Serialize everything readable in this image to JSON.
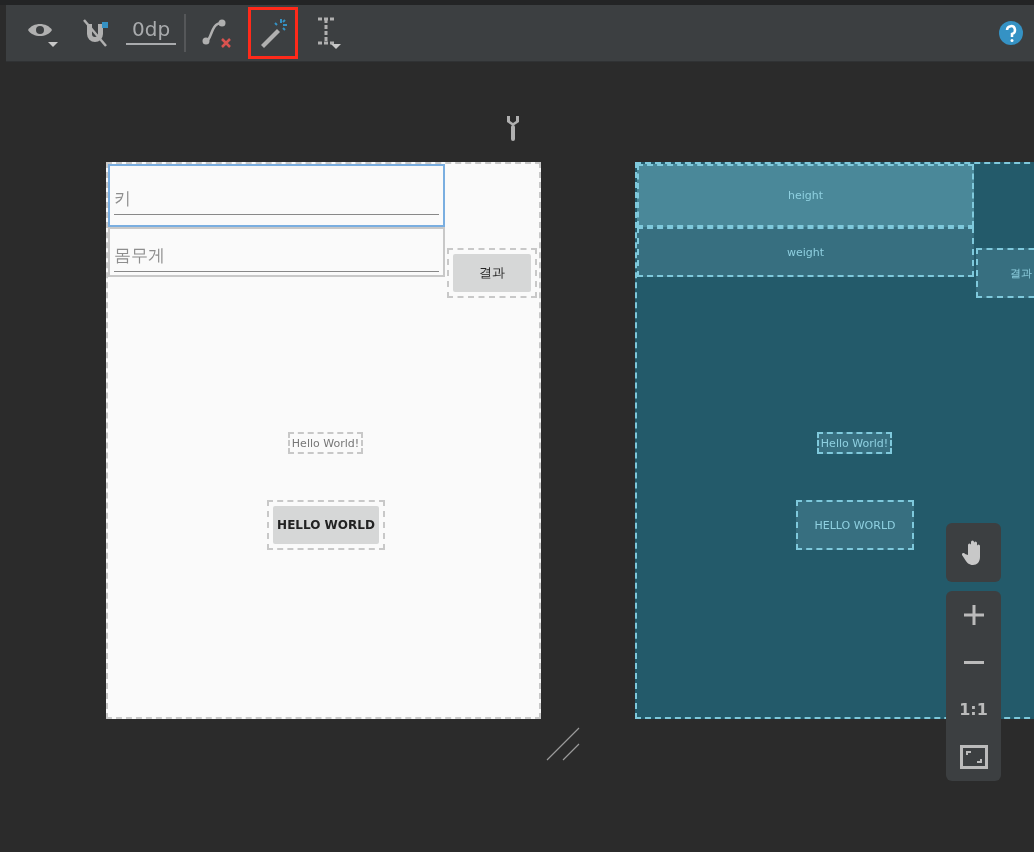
{
  "toolbar": {
    "tools": [
      {
        "kind": "eye",
        "selected": false
      },
      {
        "kind": "magnet",
        "selected": false
      },
      {
        "kind": "margin",
        "label": "0dp",
        "selected": false
      },
      {
        "kind": "clear",
        "selected": false
      },
      {
        "kind": "infer",
        "selected": true
      },
      {
        "kind": "align",
        "selected": false
      }
    ]
  },
  "design": {
    "widgets": [
      {
        "kind": "field",
        "placeholder": "키",
        "selected": true
      },
      {
        "kind": "field",
        "placeholder": "몸무게",
        "selected": false
      },
      {
        "kind": "button",
        "label": "결과",
        "selected": false
      },
      {
        "kind": "text",
        "label": "Hello World!",
        "selected": false
      },
      {
        "kind": "button",
        "label": "HELLO WORLD",
        "selected": false
      }
    ]
  },
  "blueprint": {
    "widgets": [
      {
        "label": "height",
        "selected": true
      },
      {
        "label": "weight",
        "selected": false
      },
      {
        "label": "결과",
        "selected": false
      },
      {
        "label": "Hello World!",
        "selected": false
      },
      {
        "label": "HELLO WORLD",
        "selected": false
      }
    ]
  },
  "zoom_controls": {
    "reset_label": "1:1"
  }
}
